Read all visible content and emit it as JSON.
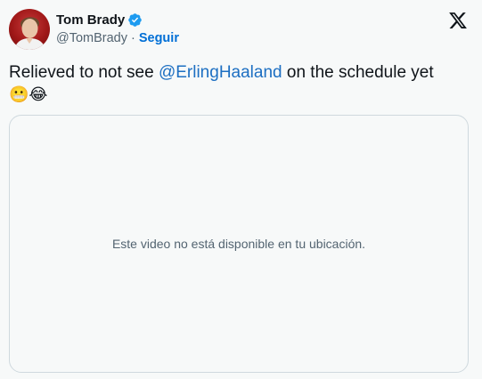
{
  "author": {
    "display_name": "Tom Brady",
    "handle": "@TomBrady",
    "separator": "·",
    "follow_label": "Seguir",
    "verified": true
  },
  "tweet": {
    "text_before": "Relieved to not see ",
    "mention": "@ErlingHaaland",
    "text_after": " on the schedule yet",
    "emojis": "😬😂"
  },
  "media": {
    "unavailable_message": "Este video no está disponible en tu ubicación."
  },
  "colors": {
    "link": "#1d6fc2",
    "verified": "#1d9bf0",
    "secondary_text": "#536471",
    "border": "#cfd9de"
  },
  "icons": {
    "brand": "x-logo-icon",
    "verified": "verified-badge-icon"
  }
}
